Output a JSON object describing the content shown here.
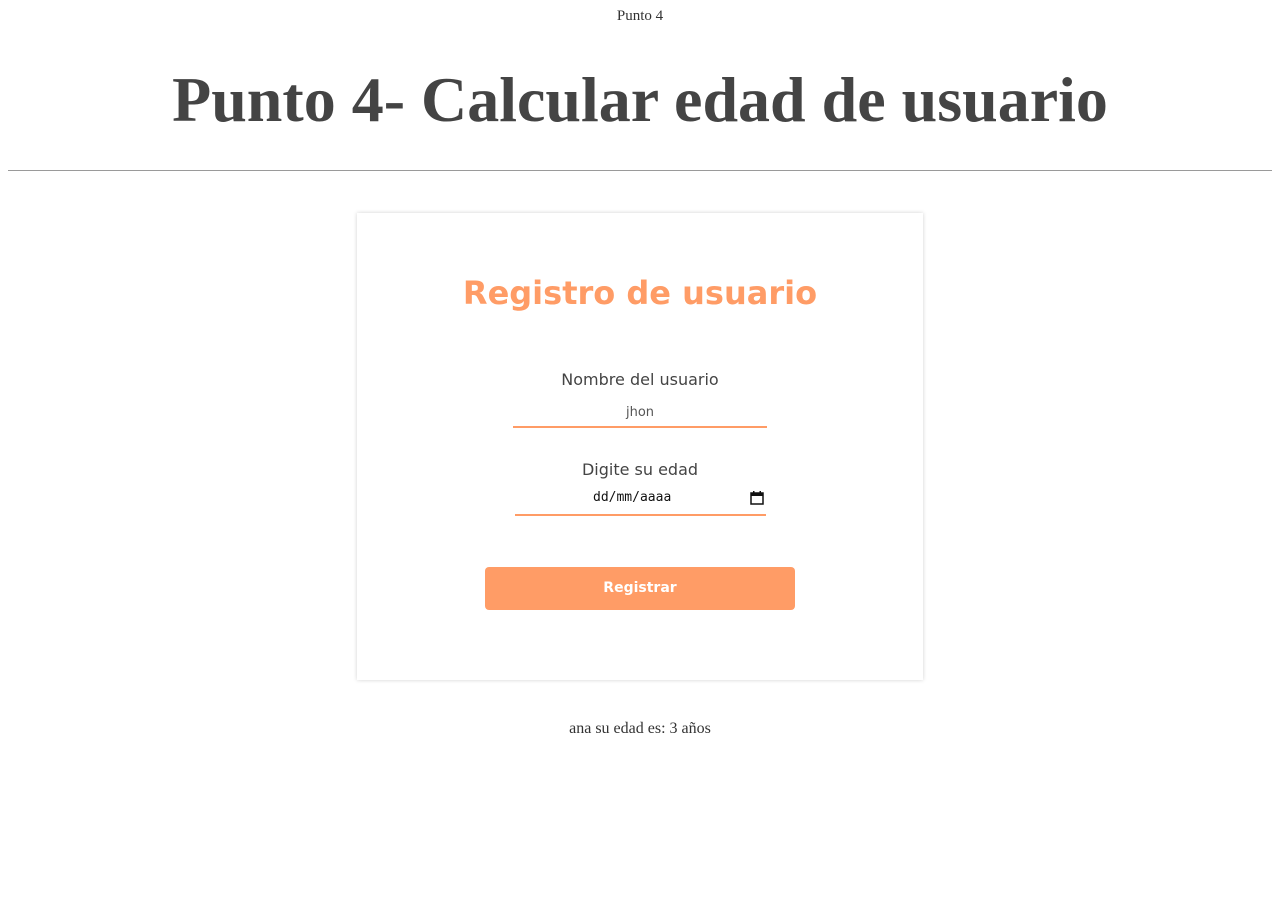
{
  "page": {
    "top_label": "Punto 4",
    "title": "Punto 4- Calcular edad de usuario"
  },
  "form": {
    "title": "Registro de usuario",
    "name_label": "Nombre del usuario",
    "name_value": "jhon",
    "age_label": "Digite su edad",
    "date_placeholder": "dd/mm/aaaa",
    "submit_label": "Registrar"
  },
  "result": {
    "text": "ana su edad es: 3 años"
  },
  "colors": {
    "accent": "#ff9c66",
    "text": "#444444",
    "divider": "#9a9a9a"
  },
  "icons": {
    "date_picker": "calendar-icon"
  }
}
